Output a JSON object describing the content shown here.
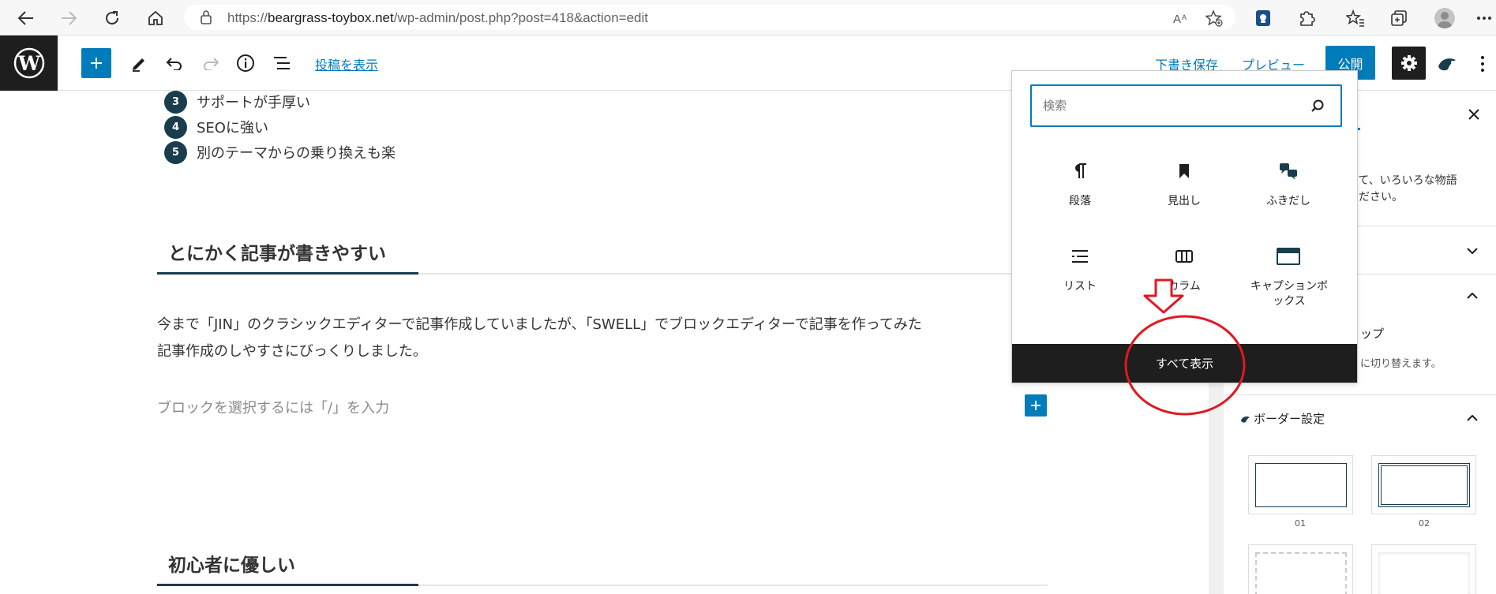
{
  "browser": {
    "url_prefix": "https://",
    "url_domain": "beargrass-toybox.net",
    "url_path": "/wp-admin/post.php?post=418&action=edit"
  },
  "toolbar": {
    "view_post": "投稿を表示",
    "save_draft": "下書き保存",
    "preview": "プレビュー",
    "publish": "公開"
  },
  "content": {
    "list_items": [
      {
        "num": "3",
        "text": "サポートが手厚い"
      },
      {
        "num": "4",
        "text": "SEOに強い"
      },
      {
        "num": "5",
        "text": "別のテーマからの乗り換えも楽"
      }
    ],
    "heading1": "とにかく記事が書きやすい",
    "paragraph_line1": "今まで「JIN」のクラシックエディターで記事作成していましたが、「SWELL」でブロックエディターで記事を作ってみた",
    "paragraph_line2": "記事作成のしやすさにびっくりしました。",
    "placeholder": "ブロックを選択するには「/」を入力",
    "heading2": "初心者に優しい"
  },
  "sidebar": {
    "desc_line1": "って、いろいろな物語",
    "desc_line2": "ください。",
    "section_text1": "ップ",
    "section_text2": "に切り替えます。",
    "border_section_title": "ボーダー設定",
    "thumb_labels": [
      "01",
      "02"
    ]
  },
  "inserter": {
    "search_placeholder": "検索",
    "blocks": [
      {
        "label": "段落",
        "icon": "paragraph-icon"
      },
      {
        "label": "見出し",
        "icon": "heading-icon"
      },
      {
        "label": "ふきだし",
        "icon": "speech-balloon-icon"
      },
      {
        "label": "リスト",
        "icon": "list-icon"
      },
      {
        "label": "カラム",
        "icon": "columns-icon"
      },
      {
        "label": "キャプションボックス",
        "icon": "caption-box-icon"
      }
    ],
    "browse_all": "すべて表示"
  },
  "colors": {
    "wp_blue": "#007cba",
    "wp_dark": "#1e1e1e",
    "heading_accent": "#1a3d4e",
    "annotation_red": "#e0191f"
  }
}
